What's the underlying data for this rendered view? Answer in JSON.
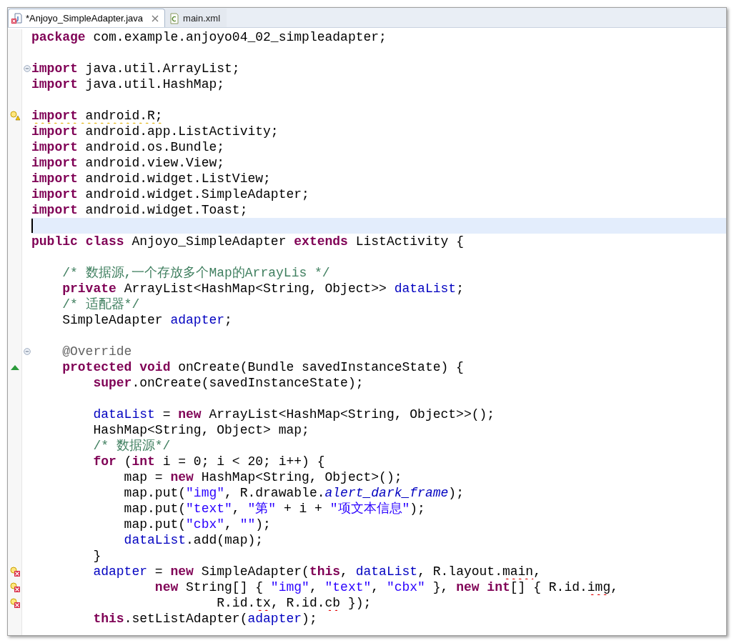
{
  "tabs": [
    {
      "label": "*Anjoyo_SimpleAdapter.java",
      "kind": "java-error",
      "selected": true,
      "closable": true
    },
    {
      "label": "main.xml",
      "kind": "xml",
      "selected": false,
      "closable": false
    }
  ],
  "lines": [
    {
      "kind": "plain",
      "current": false,
      "tokens": [
        {
          "kind": "kw",
          "text": "package"
        },
        {
          "kind": "plain",
          "text": " com.example.anjoyo04_02_simpleadapter;"
        }
      ]
    },
    {
      "kind": "plain",
      "current": false
    },
    {
      "kind": "fold",
      "current": false,
      "tokens": [
        {
          "kind": "kw",
          "text": "import"
        },
        {
          "kind": "plain",
          "text": " java.util.ArrayList;"
        }
      ]
    },
    {
      "kind": "plain",
      "current": false,
      "tokens": [
        {
          "kind": "kw",
          "text": "import"
        },
        {
          "kind": "plain",
          "text": " java.util.HashMap;"
        }
      ]
    },
    {
      "kind": "plain",
      "current": false
    },
    {
      "kind": "warning",
      "current": false,
      "tokens": [
        {
          "kind": "kw-warning",
          "text": "import"
        },
        {
          "kind": "plain-warning",
          "text": " android.R;"
        }
      ]
    },
    {
      "kind": "plain",
      "current": false,
      "tokens": [
        {
          "kind": "kw",
          "text": "import"
        },
        {
          "kind": "plain",
          "text": " android.app.ListActivity;"
        }
      ]
    },
    {
      "kind": "plain",
      "current": false,
      "tokens": [
        {
          "kind": "kw",
          "text": "import"
        },
        {
          "kind": "plain",
          "text": " android.os.Bundle;"
        }
      ]
    },
    {
      "kind": "plain",
      "current": false,
      "tokens": [
        {
          "kind": "kw",
          "text": "import"
        },
        {
          "kind": "plain",
          "text": " android.view.View;"
        }
      ]
    },
    {
      "kind": "plain",
      "current": false,
      "tokens": [
        {
          "kind": "kw",
          "text": "import"
        },
        {
          "kind": "plain",
          "text": " android.widget.ListView;"
        }
      ]
    },
    {
      "kind": "plain",
      "current": false,
      "tokens": [
        {
          "kind": "kw",
          "text": "import"
        },
        {
          "kind": "plain",
          "text": " android.widget.SimpleAdapter;"
        }
      ]
    },
    {
      "kind": "plain",
      "current": false,
      "tokens": [
        {
          "kind": "kw",
          "text": "import"
        },
        {
          "kind": "plain",
          "text": " android.widget.Toast;"
        }
      ]
    },
    {
      "kind": "plain",
      "current": true
    },
    {
      "kind": "plain",
      "current": false,
      "tokens": [
        {
          "kind": "kw",
          "text": "public "
        },
        {
          "kind": "kw",
          "text": "class"
        },
        {
          "kind": "plain",
          "text": " Anjoyo_SimpleAdapter "
        },
        {
          "kind": "kw",
          "text": "extends"
        },
        {
          "kind": "plain",
          "text": " ListActivity {"
        }
      ]
    },
    {
      "kind": "plain",
      "current": false
    },
    {
      "kind": "plain",
      "current": false,
      "tokens": [
        {
          "kind": "comment",
          "text": "    /* 数据源,一个存放多个Map的ArrayLis */"
        }
      ]
    },
    {
      "kind": "plain",
      "current": false,
      "tokens": [
        {
          "kind": "kw",
          "text": "    private"
        },
        {
          "kind": "plain",
          "text": " ArrayList<HashMap<String, Object>> "
        },
        {
          "kind": "field",
          "text": "dataList"
        },
        {
          "kind": "plain",
          "text": ";"
        }
      ]
    },
    {
      "kind": "plain",
      "current": false,
      "tokens": [
        {
          "kind": "comment",
          "text": "    /* 适配器*/"
        }
      ]
    },
    {
      "kind": "plain",
      "current": false,
      "tokens": [
        {
          "kind": "plain",
          "text": "    SimpleAdapter "
        },
        {
          "kind": "field",
          "text": "adapter"
        },
        {
          "kind": "plain",
          "text": ";"
        }
      ]
    },
    {
      "kind": "plain",
      "current": false
    },
    {
      "kind": "fold",
      "current": false,
      "tokens": [
        {
          "kind": "annotation",
          "text": "    @Override"
        }
      ]
    },
    {
      "kind": "override",
      "current": false,
      "tokens": [
        {
          "kind": "kw",
          "text": "    protected "
        },
        {
          "kind": "kw",
          "text": "void"
        },
        {
          "kind": "plain",
          "text": " onCreate(Bundle savedInstanceState) {"
        }
      ]
    },
    {
      "kind": "plain",
      "current": false,
      "tokens": [
        {
          "kind": "kw",
          "text": "        super"
        },
        {
          "kind": "plain",
          "text": ".onCreate(savedInstanceState);"
        }
      ]
    },
    {
      "kind": "plain",
      "current": false
    },
    {
      "kind": "plain",
      "current": false,
      "tokens": [
        {
          "kind": "field",
          "text": "        dataList"
        },
        {
          "kind": "plain",
          "text": " = "
        },
        {
          "kind": "kw",
          "text": "new"
        },
        {
          "kind": "plain",
          "text": " ArrayList<HashMap<String, Object>>();"
        }
      ]
    },
    {
      "kind": "plain",
      "current": false,
      "tokens": [
        {
          "kind": "plain",
          "text": "        HashMap<String, Object> map;"
        }
      ]
    },
    {
      "kind": "plain",
      "current": false,
      "tokens": [
        {
          "kind": "comment",
          "text": "        /* 数据源*/"
        }
      ]
    },
    {
      "kind": "plain",
      "current": false,
      "tokens": [
        {
          "kind": "kw",
          "text": "        for"
        },
        {
          "kind": "plain",
          "text": " ("
        },
        {
          "kind": "kw",
          "text": "int"
        },
        {
          "kind": "plain",
          "text": " i = 0; i < 20; i++) {"
        }
      ]
    },
    {
      "kind": "plain",
      "current": false,
      "tokens": [
        {
          "kind": "plain",
          "text": "            map = "
        },
        {
          "kind": "kw",
          "text": "new"
        },
        {
          "kind": "plain",
          "text": " HashMap<String, Object>();"
        }
      ]
    },
    {
      "kind": "plain",
      "current": false,
      "tokens": [
        {
          "kind": "plain",
          "text": "            map.put("
        },
        {
          "kind": "string",
          "text": "\"img\""
        },
        {
          "kind": "plain",
          "text": ", R.drawable."
        },
        {
          "kind": "static",
          "text": "alert_dark_frame"
        },
        {
          "kind": "plain",
          "text": ");"
        }
      ]
    },
    {
      "kind": "plain",
      "current": false,
      "tokens": [
        {
          "kind": "plain",
          "text": "            map.put("
        },
        {
          "kind": "string",
          "text": "\"text\""
        },
        {
          "kind": "plain",
          "text": ", "
        },
        {
          "kind": "string",
          "text": "\"第\""
        },
        {
          "kind": "plain",
          "text": " + i + "
        },
        {
          "kind": "string",
          "text": "\"项文本信息\""
        },
        {
          "kind": "plain",
          "text": ");"
        }
      ]
    },
    {
      "kind": "plain",
      "current": false,
      "tokens": [
        {
          "kind": "plain",
          "text": "            map.put("
        },
        {
          "kind": "string",
          "text": "\"cbx\""
        },
        {
          "kind": "plain",
          "text": ", "
        },
        {
          "kind": "string",
          "text": "\"\""
        },
        {
          "kind": "plain",
          "text": ");"
        }
      ]
    },
    {
      "kind": "plain",
      "current": false,
      "tokens": [
        {
          "kind": "field",
          "text": "            dataList"
        },
        {
          "kind": "plain",
          "text": ".add(map);"
        }
      ]
    },
    {
      "kind": "plain",
      "current": false,
      "tokens": [
        {
          "kind": "plain",
          "text": "        }"
        }
      ]
    },
    {
      "kind": "error",
      "current": false,
      "tokens": [
        {
          "kind": "field",
          "text": "        adapter"
        },
        {
          "kind": "plain",
          "text": " = "
        },
        {
          "kind": "kw",
          "text": "new"
        },
        {
          "kind": "plain",
          "text": " SimpleAdapter("
        },
        {
          "kind": "kw",
          "text": "this"
        },
        {
          "kind": "plain",
          "text": ", "
        },
        {
          "kind": "field",
          "text": "dataList"
        },
        {
          "kind": "plain",
          "text": ", R.layout."
        },
        {
          "kind": "plain-error",
          "text": "main"
        },
        {
          "kind": "plain",
          "text": ","
        }
      ]
    },
    {
      "kind": "error",
      "current": false,
      "tokens": [
        {
          "kind": "kw",
          "text": "                new"
        },
        {
          "kind": "plain",
          "text": " String[] { "
        },
        {
          "kind": "string",
          "text": "\"img\""
        },
        {
          "kind": "plain",
          "text": ", "
        },
        {
          "kind": "string",
          "text": "\"text\""
        },
        {
          "kind": "plain",
          "text": ", "
        },
        {
          "kind": "string",
          "text": "\"cbx\""
        },
        {
          "kind": "plain",
          "text": " }, "
        },
        {
          "kind": "kw",
          "text": "new "
        },
        {
          "kind": "kw",
          "text": "int"
        },
        {
          "kind": "plain",
          "text": "[] { R.id."
        },
        {
          "kind": "plain-error",
          "text": "img"
        },
        {
          "kind": "plain",
          "text": ","
        }
      ]
    },
    {
      "kind": "error",
      "current": false,
      "tokens": [
        {
          "kind": "plain",
          "text": "                        R.id."
        },
        {
          "kind": "plain-error",
          "text": "tx"
        },
        {
          "kind": "plain",
          "text": ", R.id."
        },
        {
          "kind": "plain-error",
          "text": "cb"
        },
        {
          "kind": "plain",
          "text": " });"
        }
      ]
    },
    {
      "kind": "plain",
      "current": false,
      "tokens": [
        {
          "kind": "kw",
          "text": "        this"
        },
        {
          "kind": "plain",
          "text": ".setListAdapter("
        },
        {
          "kind": "field",
          "text": "adapter"
        },
        {
          "kind": "plain",
          "text": ");"
        }
      ]
    }
  ]
}
